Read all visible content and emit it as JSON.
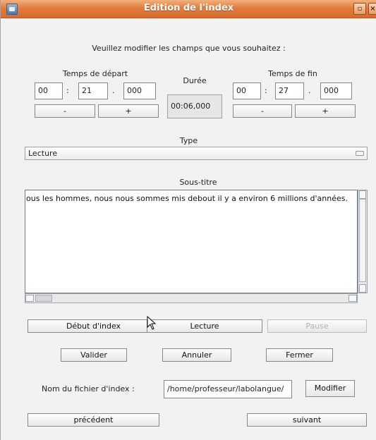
{
  "window": {
    "title": "Edition de l'index"
  },
  "instructions": "Veuillez modifier les champs que vous souhaitez :",
  "start_time": {
    "label": "Temps de départ",
    "hours": "00",
    "minutes": "21",
    "millis": "000",
    "sep1": ":",
    "sep2": ".",
    "minus": "-",
    "plus": "+"
  },
  "duration": {
    "label": "Durée",
    "value": "00:06,000"
  },
  "end_time": {
    "label": "Temps de fin",
    "hours": "00",
    "minutes": "27",
    "millis": "000",
    "sep1": ":",
    "sep2": ".",
    "minus": "-",
    "plus": "+"
  },
  "type": {
    "label": "Type",
    "selected": "Lecture"
  },
  "subtitle": {
    "label": "Sous-titre",
    "text": "ous les hommes, nous nous sommes mis debout il y a environ 6 millions d'années."
  },
  "playback": {
    "start_index": "Début d'index",
    "play": "Lecture",
    "pause": "Pause"
  },
  "actions": {
    "validate": "Valider",
    "cancel": "Annuler",
    "close": "Fermer"
  },
  "index_file": {
    "label": "Nom du fichier d'index :",
    "value": "/home/professeur/labolangue/",
    "modify": "Modifier"
  },
  "nav": {
    "previous": "précédent",
    "next": "suivant"
  },
  "icons": {
    "app": "app-window-icon",
    "maximize": "maximize-icon",
    "close": "close-icon"
  }
}
